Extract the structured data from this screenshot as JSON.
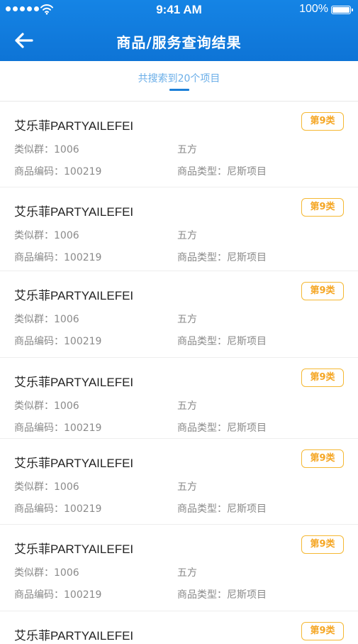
{
  "status_bar": {
    "time": "9:41 AM",
    "battery": "100%"
  },
  "header": {
    "title": "商品/服务查询结果"
  },
  "summary": {
    "text": "共搜索到20个项目"
  },
  "colors": {
    "header_blue": "#1584e5",
    "badge_orange": "#f5a623",
    "summary_blue": "#6aaee8"
  },
  "icons": {
    "back": "arrow-left-icon",
    "wifi": "wifi-icon",
    "battery": "battery-icon",
    "signal": "signal-dots-icon"
  },
  "results": [
    {
      "name": "艾乐菲PARTYAILEFEI",
      "badge": "第9类",
      "group": "类似群：1006",
      "owner": "五方",
      "code": "商品编码：100219",
      "type": "商品类型：尼斯项目"
    },
    {
      "name": "艾乐菲PARTYAILEFEI",
      "badge": "第9类",
      "group": "类似群：1006",
      "owner": "五方",
      "code": "商品编码：100219",
      "type": "商品类型：尼斯项目"
    },
    {
      "name": "艾乐菲PARTYAILEFEI",
      "badge": "第9类",
      "group": "类似群：1006",
      "owner": "五方",
      "code": "商品编码：100219",
      "type": "商品类型：尼斯项目"
    },
    {
      "name": "艾乐菲PARTYAILEFEI",
      "badge": "第9类",
      "group": "类似群：1006",
      "owner": "五方",
      "code": "商品编码：100219",
      "type": "商品类型：尼斯项目"
    },
    {
      "name": "艾乐菲PARTYAILEFEI",
      "badge": "第9类",
      "group": "类似群：1006",
      "owner": "五方",
      "code": "商品编码：100219",
      "type": "商品类型：尼斯项目"
    },
    {
      "name": "艾乐菲PARTYAILEFEI",
      "badge": "第9类",
      "group": "类似群：1006",
      "owner": "五方",
      "code": "商品编码：100219",
      "type": "商品类型：尼斯项目"
    },
    {
      "name": "艾乐菲PARTYAILEFEI",
      "badge": "第9类"
    }
  ]
}
